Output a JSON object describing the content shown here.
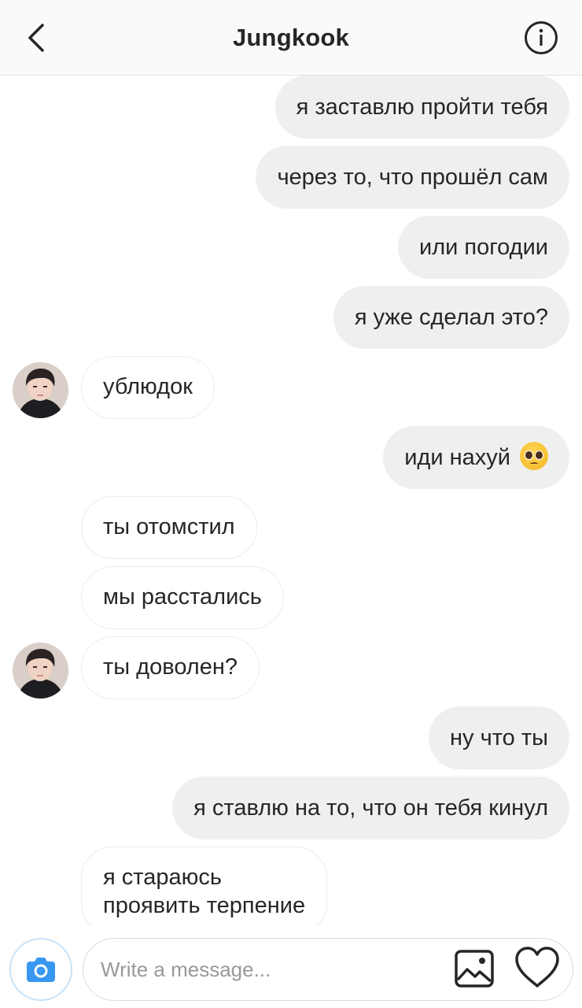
{
  "header": {
    "title": "Jungkook",
    "back_icon": "chevron-left-icon",
    "info_icon": "info-icon"
  },
  "messages": [
    {
      "side": "out",
      "text": "я заставлю пройти тебя"
    },
    {
      "side": "out",
      "text": "через то, что прошёл сам"
    },
    {
      "side": "out",
      "text": "или погодии"
    },
    {
      "side": "out",
      "text": "я уже сделал это?"
    },
    {
      "side": "in",
      "text": "ублюдок",
      "avatar": true
    },
    {
      "side": "out",
      "text": "иди нахуй",
      "emoji": "pleading-face-emoji"
    },
    {
      "side": "in",
      "text": "ты отомстил"
    },
    {
      "side": "in",
      "text": "мы расстались"
    },
    {
      "side": "in",
      "text": "ты доволен?",
      "avatar": true
    },
    {
      "side": "out",
      "text": "ну что ты"
    },
    {
      "side": "out",
      "text": "я ставлю на то, что он тебя кинул"
    },
    {
      "side": "in",
      "lines": [
        "я стараюсь",
        "проявить терпение"
      ]
    }
  ],
  "composer": {
    "placeholder": "Write a message...",
    "camera_icon": "camera-icon",
    "gallery_icon": "image-icon",
    "like_icon": "heart-icon"
  },
  "colors": {
    "outgoing_bubble": "#efefef",
    "incoming_border": "#ececec",
    "camera_accent": "#3897f0",
    "text": "#262626",
    "placeholder": "#999999"
  }
}
